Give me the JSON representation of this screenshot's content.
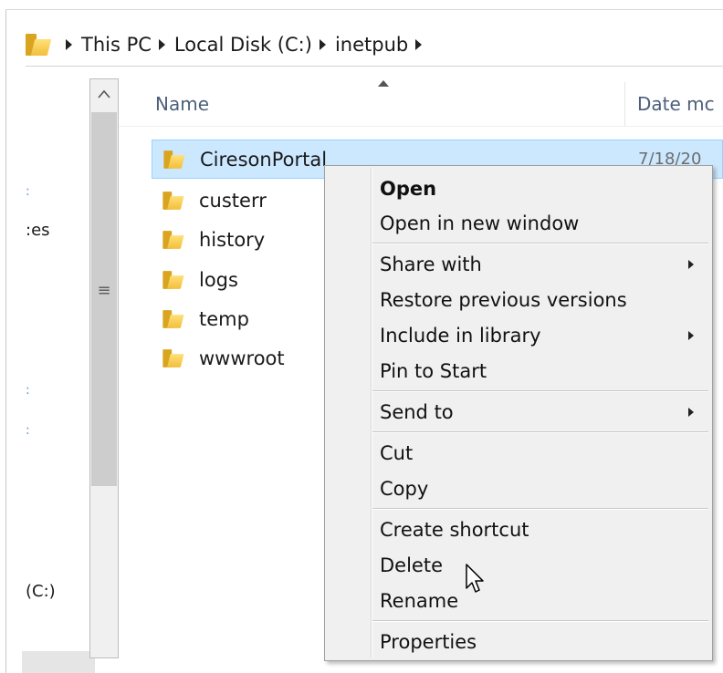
{
  "breadcrumb": {
    "items": [
      "This PC",
      "Local Disk (C:)",
      "inetpub"
    ]
  },
  "navigation": {
    "partial_label_1": ":es",
    "partial_label_selected": "(C:)"
  },
  "columns": {
    "name": "Name",
    "date_modified": "Date mc"
  },
  "files": [
    {
      "name": "CiresonPortal",
      "date": "7/18/20",
      "selected": true
    },
    {
      "name": "custerr"
    },
    {
      "name": "history"
    },
    {
      "name": "logs"
    },
    {
      "name": "temp"
    },
    {
      "name": "wwwroot"
    }
  ],
  "context_menu": {
    "open": "Open",
    "open_new_window": "Open in new window",
    "share_with": "Share with",
    "restore_previous": "Restore previous versions",
    "include_library": "Include in library",
    "pin_start": "Pin to Start",
    "send_to": "Send to",
    "cut": "Cut",
    "copy": "Copy",
    "create_shortcut": "Create shortcut",
    "delete": "Delete",
    "rename": "Rename",
    "properties": "Properties"
  },
  "colors": {
    "selection_fill": "#cce8ff",
    "selection_border": "#99d1ff",
    "menu_background": "#f0f0f0",
    "folder_yellow": "#f2bf3a",
    "header_text": "#4c607a"
  },
  "icons": {
    "address_folder": "folder-icon",
    "breadcrumb_separator": "chevron-right-icon",
    "scroll_up": "chevron-up-icon",
    "sort": "sort-ascending-icon",
    "submenu": "chevron-right-icon",
    "cursor": "mouse-pointer-icon"
  }
}
